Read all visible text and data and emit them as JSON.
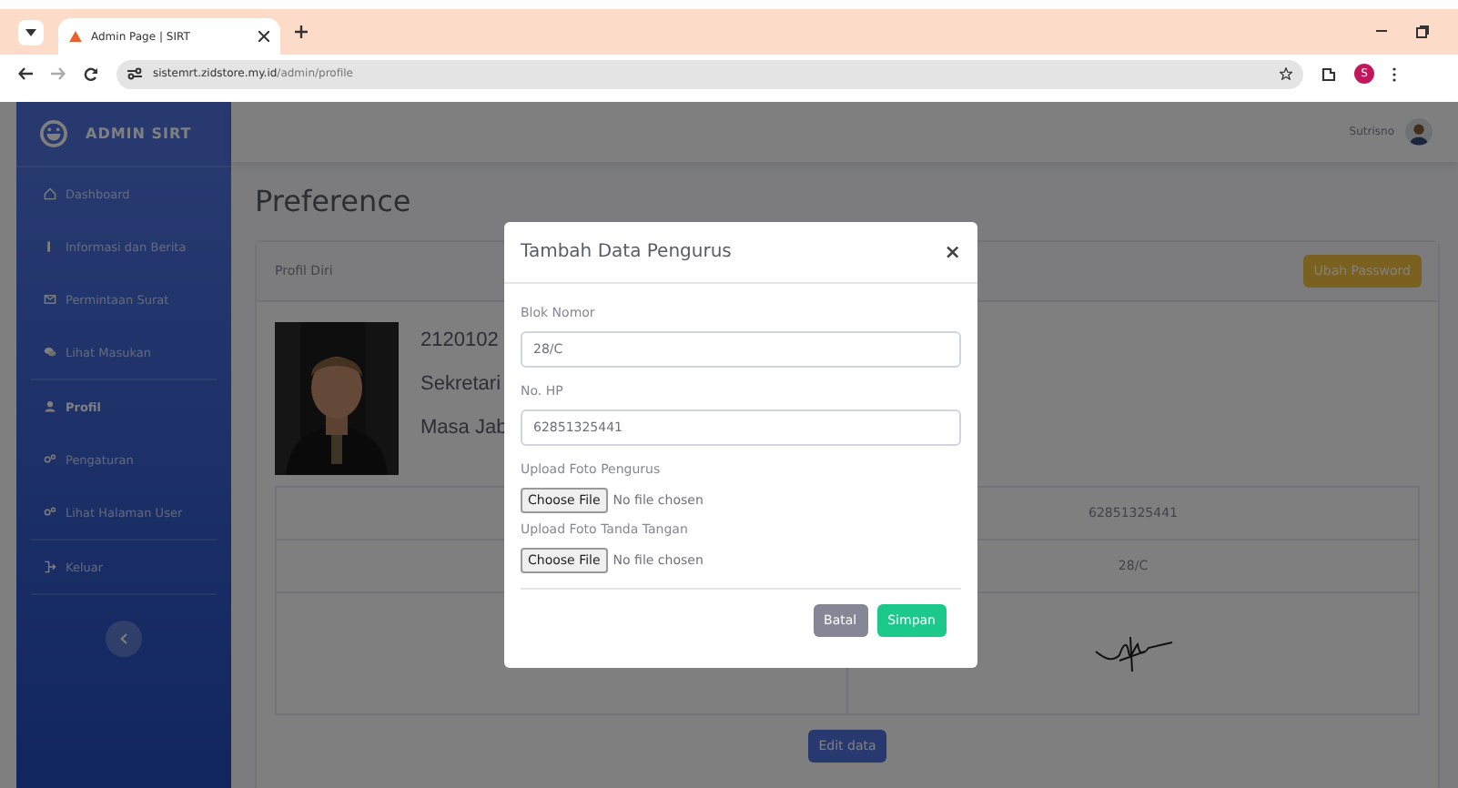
{
  "browser": {
    "tab_title": "Admin Page | SIRT",
    "url_host": "sistemrt.zidstore.my.id",
    "url_path": "/admin/profile",
    "profile_initial": "S"
  },
  "sidebar": {
    "brand": "ADMIN SIRT",
    "groups": [
      [
        {
          "label": "Dashboard",
          "selected": false
        },
        {
          "label": "Informasi dan Berita",
          "selected": false
        },
        {
          "label": "Permintaan Surat",
          "selected": false
        },
        {
          "label": "Lihat Masukan",
          "selected": false
        }
      ],
      [
        {
          "label": "Profil",
          "selected": true
        },
        {
          "label": "Pengaturan",
          "selected": false
        },
        {
          "label": "Lihat Halaman User",
          "selected": false
        }
      ],
      [
        {
          "label": "Keluar",
          "selected": false
        }
      ]
    ]
  },
  "topbar": {
    "user": "Sutrisno"
  },
  "page": {
    "title": "Preference",
    "card_title": "Profil Diri",
    "password_button": "Ubah Password",
    "profile_lines": [
      "2120102",
      "Sekretari",
      "Masa Jab"
    ],
    "table_rows": [
      {
        "kind": "text",
        "value": "62851325441"
      },
      {
        "kind": "text",
        "value": "28/C"
      },
      {
        "kind": "signature"
      }
    ],
    "edit_button": "Edit data"
  },
  "modal": {
    "title": "Tambah Data Pengurus",
    "close": "×",
    "fields": [
      {
        "kind": "text",
        "label": "Blok Nomor",
        "value": "28/C"
      },
      {
        "kind": "text",
        "label": "No. HP",
        "value": "62851325441"
      },
      {
        "kind": "file",
        "label": "Upload Foto Pengurus",
        "button": "Choose File",
        "status": "No file chosen"
      },
      {
        "kind": "file",
        "label": "Upload Foto Tanda Tangan",
        "button": "Choose File",
        "status": "No file chosen"
      }
    ],
    "buttons": [
      {
        "label": "Batal",
        "kind": "secondary"
      },
      {
        "label": "Simpan",
        "kind": "primary"
      }
    ]
  }
}
